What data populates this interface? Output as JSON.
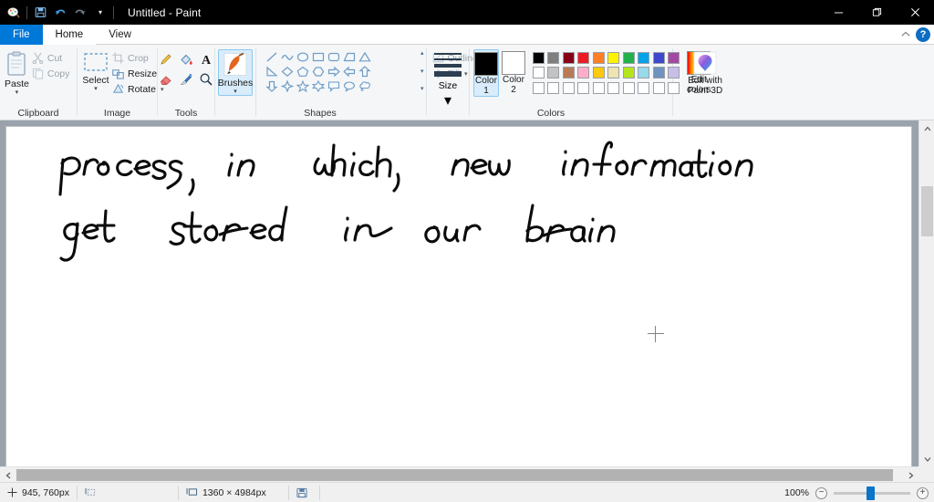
{
  "window": {
    "title": "Untitled - Paint",
    "quick_access": [
      {
        "name": "paint-app-icon",
        "glyph": "✎"
      },
      {
        "name": "save-icon",
        "glyph": "💾"
      },
      {
        "name": "undo-icon",
        "glyph": "↶"
      },
      {
        "name": "redo-icon",
        "glyph": "↷"
      },
      {
        "name": "customize-qat-icon",
        "glyph": "▾"
      }
    ],
    "controls": {
      "minimize": "—",
      "maximize": "❐",
      "close": "✕"
    }
  },
  "tabs": {
    "file": "File",
    "items": [
      {
        "label": "Home",
        "active": true
      },
      {
        "label": "View",
        "active": false
      }
    ],
    "collapse_ribbon": "⌃",
    "help": "?"
  },
  "ribbon": {
    "groups": [
      {
        "name": "clipboard",
        "label": "Clipboard",
        "big_button": {
          "label": "Paste",
          "caret": "▾",
          "icon": "clipboard-icon"
        },
        "commands": [
          {
            "label": "Cut",
            "icon": "scissors-icon",
            "enabled": false
          },
          {
            "label": "Copy",
            "icon": "copy-icon",
            "enabled": false
          }
        ]
      },
      {
        "name": "image",
        "label": "Image",
        "big_button": {
          "label": "Select",
          "caret": "▾",
          "icon": "select-rectangle-icon"
        },
        "commands": [
          {
            "label": "Crop",
            "icon": "crop-icon",
            "enabled": false
          },
          {
            "label": "Resize",
            "icon": "resize-icon",
            "enabled": true
          },
          {
            "label": "Rotate",
            "icon": "rotate-icon",
            "enabled": true,
            "caret": "▾"
          }
        ]
      },
      {
        "name": "tools",
        "label": "Tools",
        "items": [
          {
            "name": "pencil-tool",
            "title": "Pencil"
          },
          {
            "name": "fill-with-color-tool",
            "title": "Fill with color"
          },
          {
            "name": "text-tool",
            "title": "Text"
          },
          {
            "name": "eraser-tool",
            "title": "Eraser"
          },
          {
            "name": "color-picker-tool",
            "title": "Color picker"
          },
          {
            "name": "magnifier-tool",
            "title": "Magnifier"
          }
        ]
      },
      {
        "name": "brushes",
        "label": "",
        "big_button": {
          "label": "Brushes",
          "caret": "▾",
          "icon": "brush-icon",
          "selected": true
        }
      },
      {
        "name": "shapes",
        "label": "Shapes",
        "rows": [
          [
            "line",
            "curve",
            "oval",
            "rectangle",
            "rounded-rectangle",
            "polygon",
            "triangle"
          ],
          [
            "right-triangle",
            "diamond",
            "pentagon",
            "hexagon",
            "right-arrow",
            "left-arrow",
            "up-arrow"
          ],
          [
            "down-arrow",
            "four-point-star",
            "five-point-star",
            "six-point-star",
            "rounded-callout",
            "oval-callout",
            "cloud-callout"
          ]
        ],
        "scroll": [
          "▲",
          "▼",
          "▾"
        ],
        "commands": [
          {
            "label": "Outline",
            "icon": "outline-icon",
            "enabled": false,
            "caret": "▾"
          },
          {
            "label": "Fill",
            "icon": "fill-icon",
            "enabled": false,
            "caret": "▾"
          }
        ]
      },
      {
        "name": "size",
        "label": "",
        "big_button": {
          "label": "Size",
          "caret": "▾",
          "icon": "size-lines-icon"
        }
      },
      {
        "name": "colors",
        "label": "Colors",
        "color1": {
          "label_top": "Color",
          "label_bottom": "1",
          "value": "#000000",
          "selected": true
        },
        "color2": {
          "label_top": "Color",
          "label_bottom": "2",
          "value": "#ffffff",
          "selected": false
        },
        "palette_row1": [
          "#000000",
          "#7f7f7f",
          "#880015",
          "#ed1c24",
          "#ff7f27",
          "#fff200",
          "#22b14c",
          "#00a2e8",
          "#3f48cc",
          "#a349a4"
        ],
        "palette_row2": [
          "#ffffff",
          "#c3c3c3",
          "#b97a57",
          "#ffaec9",
          "#ffc90e",
          "#efe4b0",
          "#b5e61d",
          "#99d9ea",
          "#7092be",
          "#c8bfe7"
        ],
        "palette_row3": [
          "#ffffff",
          "#ffffff",
          "#ffffff",
          "#ffffff",
          "#ffffff",
          "#ffffff",
          "#ffffff",
          "#ffffff",
          "#ffffff",
          "#ffffff"
        ],
        "edit_colors": {
          "label_top": "Edit",
          "label_bottom": "colors",
          "icon": "rainbow-palette-icon"
        }
      },
      {
        "name": "paint3d",
        "label": "",
        "button": {
          "label_top": "Edit with",
          "label_bottom": "Paint 3D",
          "icon": "paint3d-icon"
        }
      }
    ]
  },
  "canvas": {
    "handwriting_line1": "process, in which, new information",
    "handwriting_line2": "get stored in our brain",
    "cursor": "crosshair-cursor"
  },
  "status": {
    "cursor_position": "945, 760px",
    "selection_size": "",
    "image_size": "1360 × 4984px",
    "file_size": "",
    "icons": {
      "position": "position-icon",
      "selection": "selection-size-icon",
      "image": "image-size-icon",
      "save": "file-size-icon"
    },
    "zoom": {
      "level": "100%",
      "zoom_out": "−",
      "zoom_in": "+"
    }
  }
}
